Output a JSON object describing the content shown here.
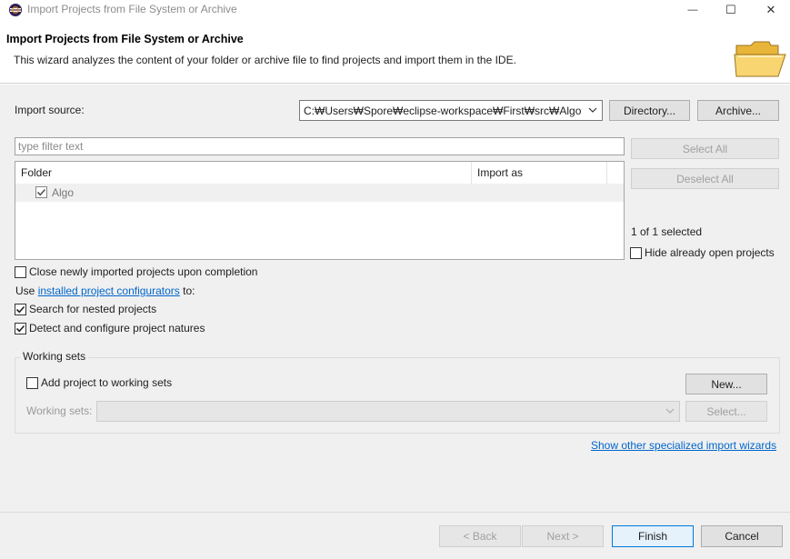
{
  "window": {
    "title": "Import Projects from File System or Archive",
    "minimize_glyph": "—",
    "maximize_glyph": "☐",
    "close_glyph": "✕"
  },
  "header": {
    "title": "Import Projects from File System or Archive",
    "description": "This wizard analyzes the content of your folder or archive file to find projects and import them in the IDE.",
    "banner_icon": "folder-open-icon"
  },
  "source": {
    "label": "Import source:",
    "path": "C:₩Users₩Spore₩eclipse-workspace₩First₩src₩Algo",
    "directory_button": "Directory...",
    "archive_button": "Archive..."
  },
  "filter": {
    "placeholder": "type filter text",
    "value": ""
  },
  "table": {
    "columns": [
      "Folder",
      "Import as"
    ],
    "rows": [
      {
        "folder": "Algo",
        "import_as": "",
        "checked": true
      }
    ]
  },
  "side": {
    "select_all": "Select All",
    "deselect_all": "Deselect All",
    "selected_count": "1 of 1 selected",
    "hide_open_label": "Hide already open projects",
    "hide_open_checked": false
  },
  "options": {
    "close_imported_label": "Close newly imported projects upon completion",
    "close_imported_checked": false,
    "use_prefix": "Use",
    "configurators_link": "installed project configurators",
    "use_suffix": "to:",
    "search_nested_label": "Search for nested projects",
    "search_nested_checked": true,
    "detect_natures_label": "Detect and configure project natures",
    "detect_natures_checked": true
  },
  "working_sets": {
    "group_title": "Working sets",
    "add_label": "Add project to working sets",
    "add_checked": false,
    "new_button": "New...",
    "sets_label": "Working sets:",
    "sets_value": "",
    "select_button": "Select..."
  },
  "other_wizards_link": "Show other specialized import wizards",
  "footer": {
    "back": "< Back",
    "next": "Next >",
    "finish": "Finish",
    "cancel": "Cancel"
  },
  "colors": {
    "link": "#0066cc",
    "dialog_bg": "#f0f0f0",
    "primary_border": "#0078d7",
    "folder_icon": "#f4c24f"
  }
}
